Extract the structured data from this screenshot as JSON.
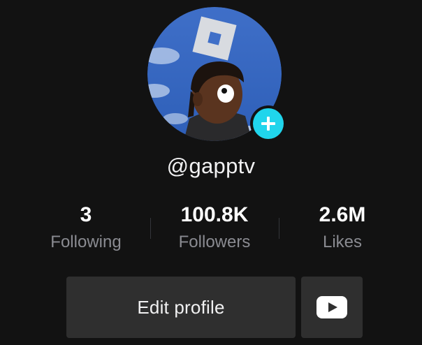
{
  "profile": {
    "username": "@gapptv",
    "avatar_icon": "profile-avatar-image",
    "add_icon": "plus-icon"
  },
  "stats": [
    {
      "value": "3",
      "label": "Following"
    },
    {
      "value": "100.8K",
      "label": "Followers"
    },
    {
      "value": "2.6M",
      "label": "Likes"
    }
  ],
  "actions": {
    "edit_profile_label": "Edit profile",
    "youtube_icon": "youtube-icon"
  },
  "colors": {
    "background": "#121212",
    "button_bg": "#2f2f2f",
    "add_accent": "#20d5ec",
    "label_gray": "#8a8b91"
  }
}
